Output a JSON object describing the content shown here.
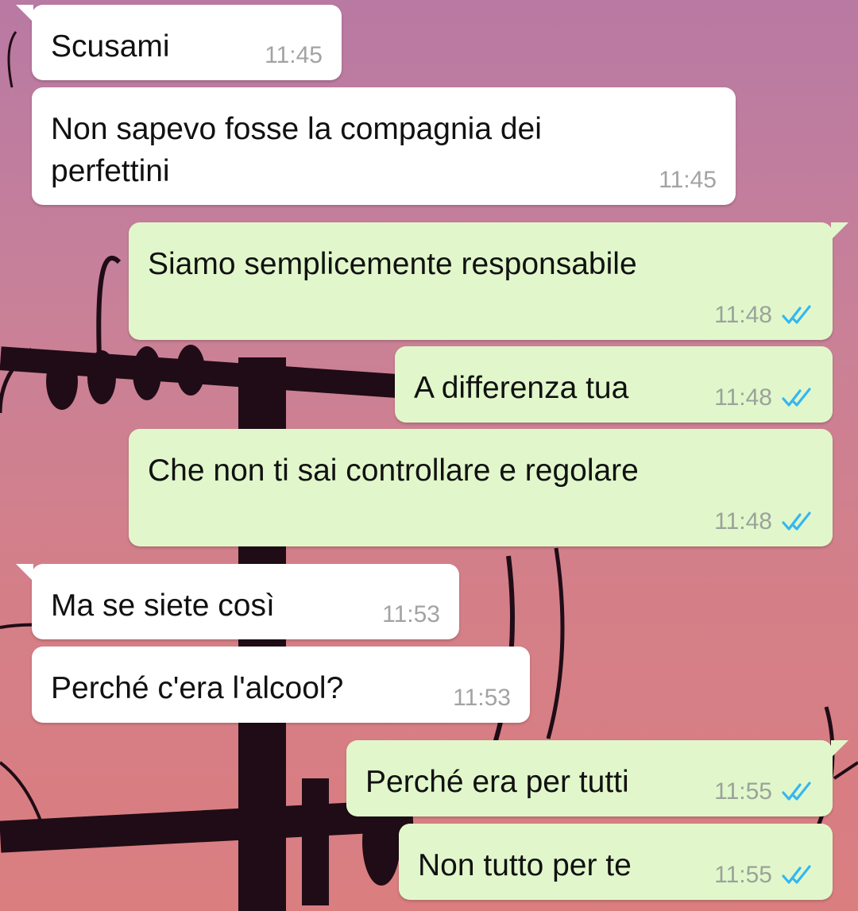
{
  "colors": {
    "incoming_bubble": "#ffffff",
    "outgoing_bubble": "#e1f7cb",
    "read_ticks": "#34b7f1",
    "time_text": "#9aa39a"
  },
  "messages": [
    {
      "direction": "in",
      "text": "Scusami",
      "time": "11:45"
    },
    {
      "direction": "in",
      "text": "Non sapevo fosse la compagnia dei perfettini",
      "time": "11:45"
    },
    {
      "direction": "out",
      "text": "Siamo semplicemente responsabile",
      "time": "11:48",
      "status_icon": "double-check-icon"
    },
    {
      "direction": "out",
      "text": "A differenza tua",
      "time": "11:48",
      "status_icon": "double-check-icon"
    },
    {
      "direction": "out",
      "text": "Che non ti sai controllare e regolare",
      "time": "11:48",
      "status_icon": "double-check-icon"
    },
    {
      "direction": "in",
      "text": "Ma se siete così",
      "time": "11:53"
    },
    {
      "direction": "in",
      "text": "Perché c'era l'alcool?",
      "time": "11:53"
    },
    {
      "direction": "out",
      "text": "Perché era per tutti",
      "time": "11:55",
      "status_icon": "double-check-icon"
    },
    {
      "direction": "out",
      "text": "Non tutto per te",
      "time": "11:55",
      "status_icon": "double-check-icon"
    }
  ]
}
